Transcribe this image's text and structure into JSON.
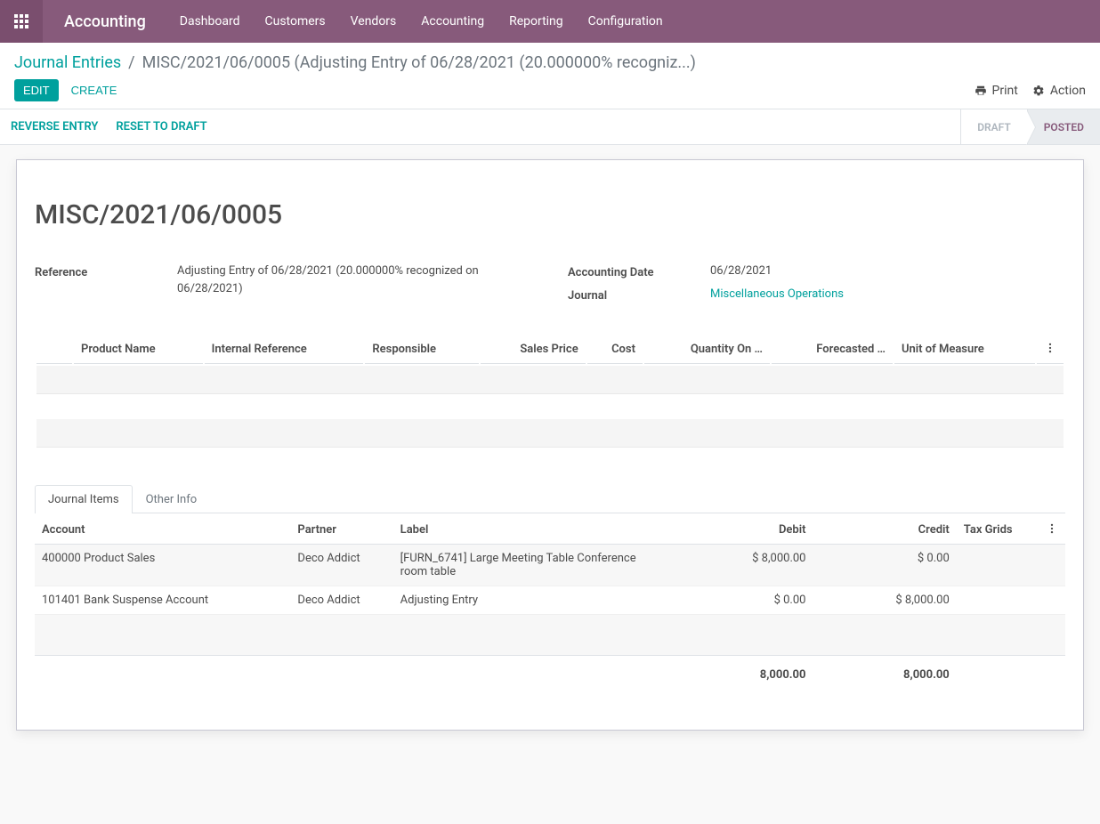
{
  "navbar": {
    "brand": "Accounting",
    "menu": [
      "Dashboard",
      "Customers",
      "Vendors",
      "Accounting",
      "Reporting",
      "Configuration"
    ]
  },
  "breadcrumb": {
    "parent": "Journal Entries",
    "current": "MISC/2021/06/0005 (Adjusting Entry of 06/28/2021 (20.000000% recogniz...)"
  },
  "buttons": {
    "edit": "EDIT",
    "create": "CREATE",
    "print": "Print",
    "action": "Action",
    "reverse": "REVERSE ENTRY",
    "reset": "RESET TO DRAFT"
  },
  "status": {
    "draft": "DRAFT",
    "posted": "POSTED"
  },
  "record": {
    "name": "MISC/2021/06/0005",
    "reference_label": "Reference",
    "reference_value": "Adjusting Entry of 06/28/2021 (20.000000% recognized on 06/28/2021)",
    "date_label": "Accounting Date",
    "date_value": "06/28/2021",
    "journal_label": "Journal",
    "journal_value": "Miscellaneous Operations"
  },
  "upper_columns": [
    "Product Name",
    "Internal Reference",
    "Responsible",
    "Sales Price",
    "Cost",
    "Quantity On …",
    "Forecasted …",
    "Unit of Measure"
  ],
  "tabs": {
    "items": "Journal Items",
    "other": "Other Info"
  },
  "journal_columns": {
    "account": "Account",
    "partner": "Partner",
    "label": "Label",
    "debit": "Debit",
    "credit": "Credit",
    "tax": "Tax Grids"
  },
  "journal_rows": [
    {
      "account": "400000 Product Sales",
      "partner": "Deco Addict",
      "label": "[FURN_6741] Large Meeting Table Conference room table",
      "debit": "$ 8,000.00",
      "credit": "$ 0.00",
      "tax": ""
    },
    {
      "account": "101401 Bank Suspense Account",
      "partner": "Deco Addict",
      "label": "Adjusting Entry",
      "debit": "$ 0.00",
      "credit": "$ 8,000.00",
      "tax": ""
    }
  ],
  "totals": {
    "debit": "8,000.00",
    "credit": "8,000.00"
  }
}
